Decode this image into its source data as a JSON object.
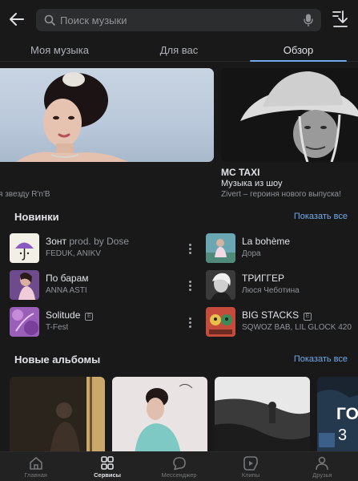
{
  "search": {
    "placeholder": "Поиск музыки"
  },
  "tabs": [
    {
      "label": "Моя музыка",
      "active": false
    },
    {
      "label": "Для вас",
      "active": false
    },
    {
      "label": "Обзор",
      "active": true
    }
  ],
  "banners": [
    {
      "title": "",
      "subtitle": "",
      "description": "я звезду R'n'B"
    },
    {
      "title": "MC TAXI",
      "subtitle": "Музыка из шоу",
      "description": "Zivert – героиня нового выпуска!"
    }
  ],
  "new_releases": {
    "title": "Новинки",
    "show_all": "Показать все",
    "tracks": [
      {
        "title": "Зонт",
        "title_suffix": " prod. by Dose",
        "artist": "FEDUK, ANIKV",
        "explicit": false,
        "cover_color": "#f2efe6"
      },
      {
        "title": "La bohème",
        "title_suffix": "",
        "artist": "Дора",
        "explicit": false,
        "cover_color": "#6aa7b3"
      },
      {
        "title": "По барам",
        "title_suffix": "",
        "artist": "ANNA ASTI",
        "explicit": false,
        "cover_color": "#8c5fa8"
      },
      {
        "title": "ТРИГГЕР",
        "title_suffix": "",
        "artist": "Люся Чеботина",
        "explicit": false,
        "cover_color": "#3a3a3a"
      },
      {
        "title": "Solitude",
        "title_suffix": "",
        "artist": "T-Fest",
        "explicit": true,
        "explicit_mark": "E",
        "cover_color": "#9a5fb8"
      },
      {
        "title": "BIG STACKS",
        "title_suffix": "",
        "artist": "SQWOZ BAB, LIL GLOCK 420",
        "explicit": true,
        "explicit_mark": "E",
        "cover_color": "#c64b3c"
      }
    ]
  },
  "new_albums": {
    "title": "Новые альбомы",
    "show_all": "Показать все",
    "partial_cover_text": "ГО",
    "partial_cover_number": "3"
  },
  "bottom_nav": [
    {
      "label": "Главная",
      "icon": "home-icon",
      "active": false
    },
    {
      "label": "Сервисы",
      "icon": "services-icon",
      "active": true
    },
    {
      "label": "Мессенджер",
      "icon": "messenger-icon",
      "active": false
    },
    {
      "label": "Клипы",
      "icon": "clips-icon",
      "active": false
    },
    {
      "label": "Друзья",
      "icon": "friends-icon",
      "active": false
    }
  ],
  "colors": {
    "accent": "#71aaeb",
    "background": "#19191a",
    "nav_background": "#222223"
  }
}
